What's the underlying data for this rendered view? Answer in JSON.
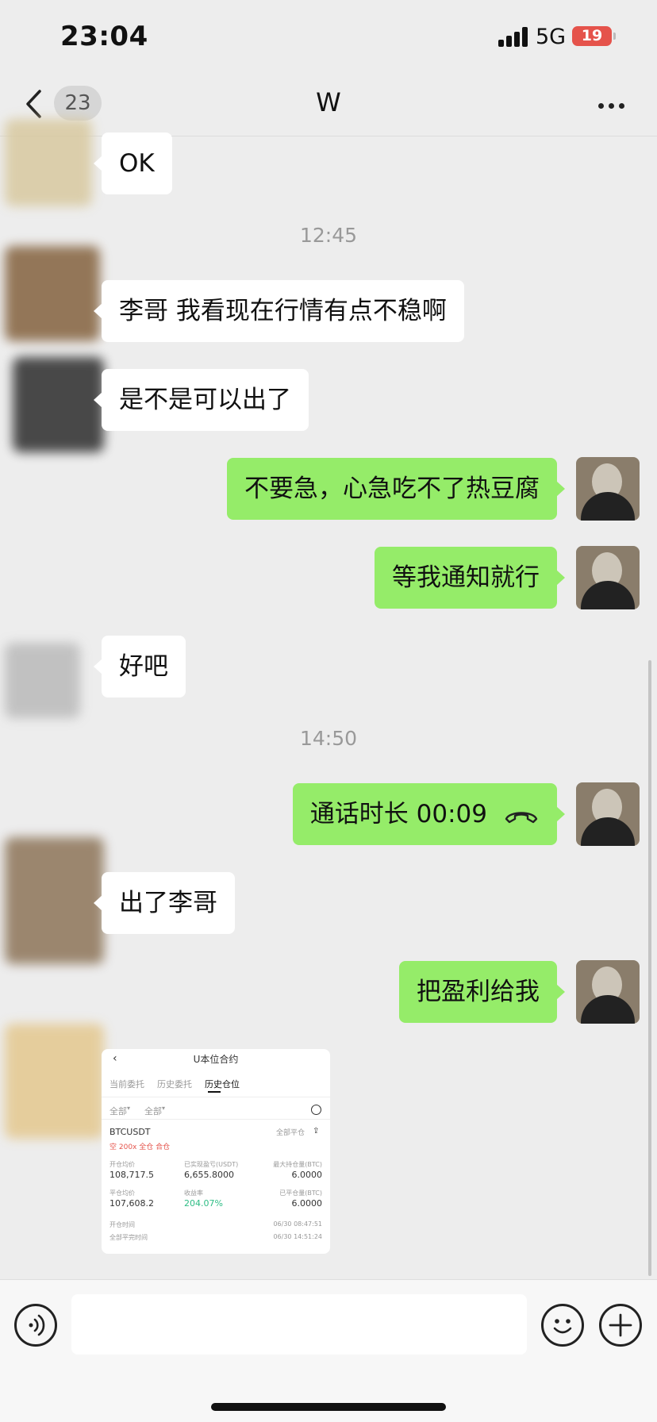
{
  "status_bar": {
    "time": "23:04",
    "network": "5G",
    "battery": "19"
  },
  "header": {
    "unread_count": "23",
    "title": "W"
  },
  "messages": [
    {
      "text": "OK"
    },
    {
      "text": "李哥 我看现在行情有点不稳啊"
    },
    {
      "text": "是不是可以出了"
    },
    {
      "text": "不要急，心急吃不了热豆腐"
    },
    {
      "text": "等我通知就行"
    },
    {
      "text": "好吧"
    },
    {
      "text": "出了李哥"
    },
    {
      "text": "把盈利给我"
    }
  ],
  "timestamps": [
    "12:45",
    "14:50"
  ],
  "call": {
    "label": "通话时长 00:09"
  },
  "screenshot": {
    "title": "U本位合约",
    "tabs": [
      "当前委托",
      "历史委托",
      "历史仓位"
    ],
    "filters": [
      "全部",
      "全部"
    ],
    "symbol": "BTCUSDT",
    "close_all": "全部平仓",
    "tags": "空 200x 全仓 合仓",
    "open_price_label": "开仓均价",
    "open_price": "108,717.5",
    "pnl_label": "已实现盈亏(USDT)",
    "pnl": "6,655.8000",
    "max_pos_label": "最大持仓量(BTC)",
    "max_pos": "6.0000",
    "close_price_label": "平仓均价",
    "close_price": "107,608.2",
    "roi_label": "收益率",
    "roi": "204.07%",
    "closed_pos_label": "已平仓量(BTC)",
    "closed_pos": "6.0000",
    "open_time_label": "开仓时间",
    "open_time": "06/30 08:47:51",
    "close_time_label": "全部平完时间",
    "close_time": "06/30 14:51:24"
  },
  "colors": {
    "background": "#ededed",
    "bubble_outgoing": "#95ec69",
    "bubble_incoming": "#ffffff",
    "roi_green": "#2ebd85",
    "battery_red": "#e5534b"
  }
}
